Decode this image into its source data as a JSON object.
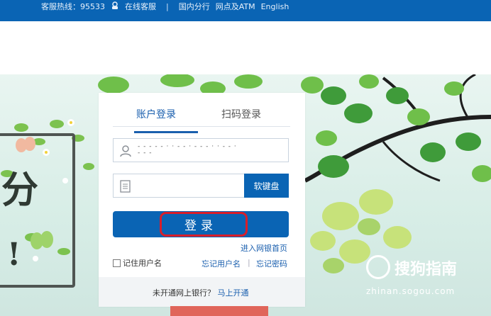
{
  "topbar": {
    "hotline": "客服热线：95533",
    "service": "在线客服",
    "sep": "|",
    "links": [
      "国内分行",
      "网点及ATM",
      "English"
    ]
  },
  "login": {
    "tabs": [
      {
        "label": "账户登录",
        "active": true
      },
      {
        "label": "扫码登录",
        "active": false
      }
    ],
    "username_value": "- - - - - · · - - · - - - · · - - ·",
    "username_value2": "- - -",
    "softkey_label": "软键盘",
    "login_label": "登录",
    "enter_home": "进入网银首页",
    "remember_label": "记住用户名",
    "forgot_user": "忘记用户名",
    "divider": "|",
    "forgot_pwd": "忘记密码",
    "footer_text": "未开通网上银行？",
    "footer_link": "马上开通"
  },
  "promo": {
    "chars": [
      "分",
      "!"
    ]
  },
  "watermark": {
    "brand": "搜狗指南",
    "url": "zhinan.sogou.com"
  },
  "colors": {
    "brand_blue": "#0a64b4",
    "link_blue": "#1a5fae",
    "highlight_red": "#d91e2a"
  }
}
